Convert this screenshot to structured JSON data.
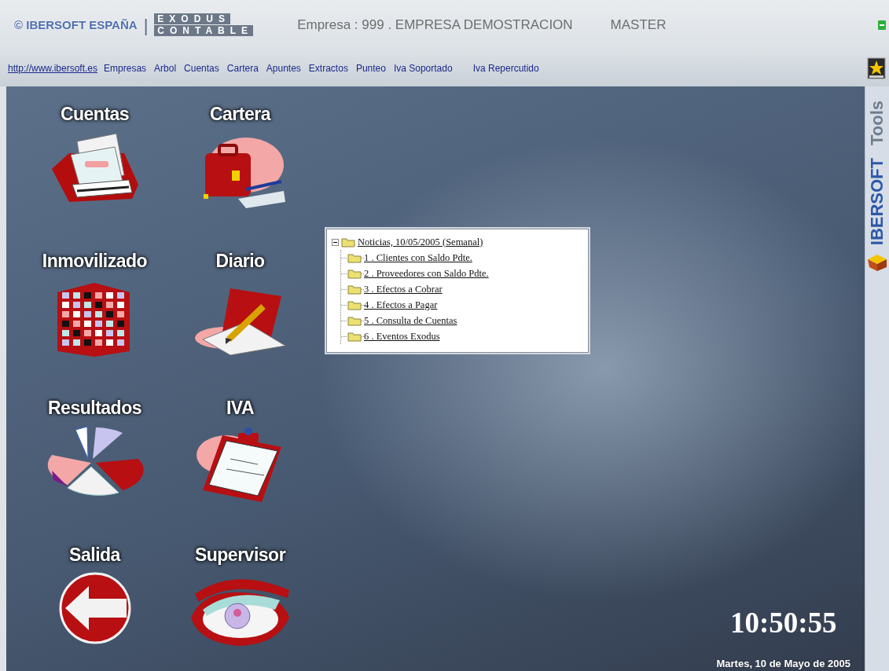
{
  "header": {
    "brand": "© IBERSOFT ESPAÑA",
    "separator": "|",
    "product_top": "EXODUS",
    "product_bottom": "CONTABLE",
    "company": "Empresa : 999 . EMPRESA DEMOSTRACION",
    "user": "MASTER"
  },
  "nav": {
    "links": [
      {
        "label": "http://www.ibersoft.es",
        "kind": "url"
      },
      {
        "label": "Empresas",
        "kind": "menu"
      },
      {
        "label": "Arbol",
        "kind": "menu"
      },
      {
        "label": "Cuentas",
        "kind": "menu"
      },
      {
        "label": "Cartera",
        "kind": "menu"
      },
      {
        "label": "Apuntes",
        "kind": "menu"
      },
      {
        "label": "Extractos",
        "kind": "menu"
      },
      {
        "label": "Punteo",
        "kind": "menu"
      },
      {
        "label": "Iva Soportado",
        "kind": "menu"
      },
      {
        "label": "Iva Repercutido",
        "kind": "menu"
      }
    ]
  },
  "modules": [
    {
      "label": "Cuentas",
      "kind": "ledger"
    },
    {
      "label": "Cartera",
      "kind": "briefcase"
    },
    {
      "label": "Inmovilizado",
      "kind": "building"
    },
    {
      "label": "Diario",
      "kind": "pencil"
    },
    {
      "label": "Resultados",
      "kind": "pie"
    },
    {
      "label": "IVA",
      "kind": "clipboard"
    },
    {
      "label": "Salida",
      "kind": "exit"
    },
    {
      "label": "Supervisor",
      "kind": "eye"
    }
  ],
  "tree": {
    "label": "Noticias, 10/05/2005 (Semanal)",
    "expanded": true,
    "children": [
      {
        "label": "1 . Clientes con Saldo Pdte."
      },
      {
        "label": "2 . Proveedores con Saldo Pdte."
      },
      {
        "label": "3 . Efectos a Cobrar"
      },
      {
        "label": "4 . Efectos a Pagar"
      },
      {
        "label": "5 . Consulta de Cuentas"
      },
      {
        "label": "6 . Eventos Exodus"
      }
    ]
  },
  "clock": {
    "time": "10:50:55",
    "date": "Martes, 10 de Mayo de 2005"
  },
  "side_panel": {
    "brand": "IBERSOFT",
    "label": "Tools"
  }
}
